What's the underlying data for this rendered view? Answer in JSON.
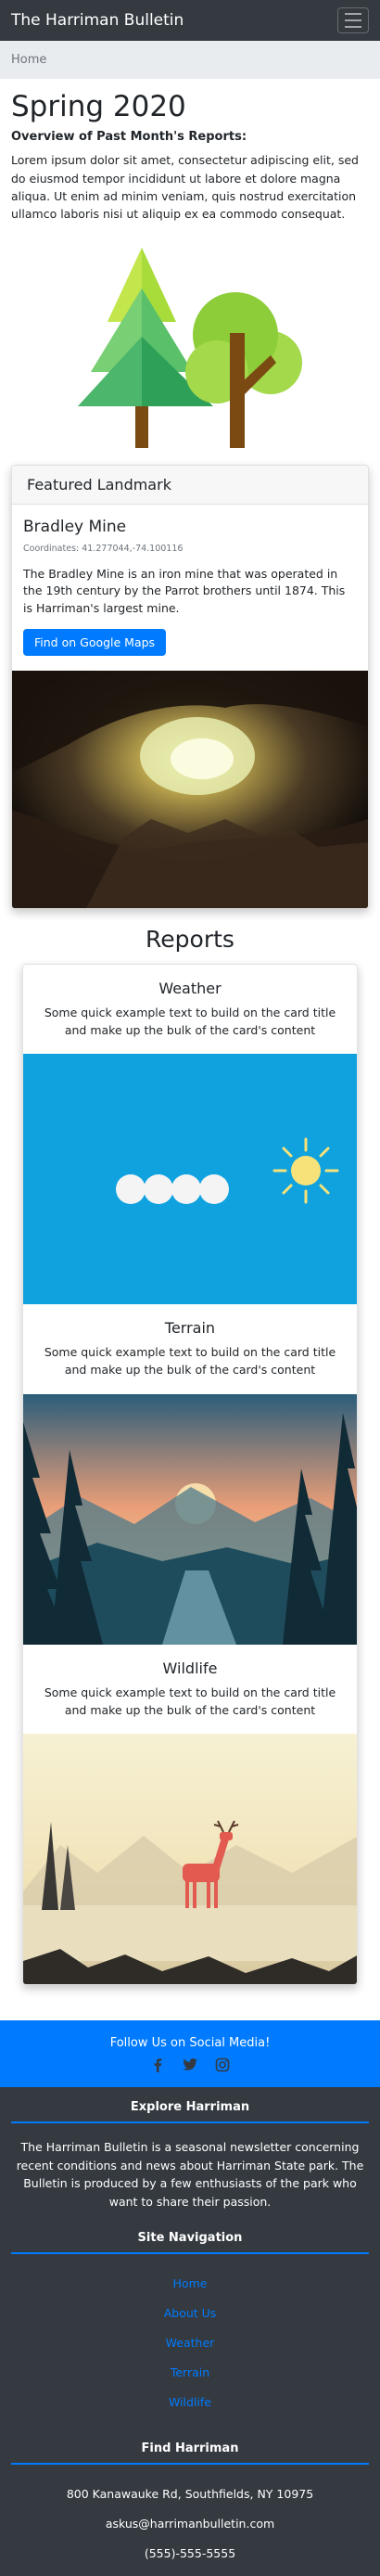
{
  "navbar": {
    "brand": "The Harriman Bulletin",
    "menu_icon": "hamburger-menu-icon"
  },
  "breadcrumb": {
    "home_label": "Home"
  },
  "intro": {
    "title": "Spring 2020",
    "subtitle": "Overview of Past Month's Reports:",
    "text": "Lorem ipsum dolor sit amet, consectetur adipiscing elit, sed do eiusmod tempor incididunt ut labore et dolore magna aliqua. Ut enim ad minim veniam, quis nostrud exercitation ullamco laboris nisi ut aliquip ex ea commodo consequat."
  },
  "featured": {
    "header": "Featured Landmark",
    "name": "Bradley Mine",
    "coordinates": "Coordinates: 41.277044,-74.100116",
    "description": "The Bradley Mine is an iron mine that was operated in the 19th century by the Parrot brothers until 1874. This is Harriman's largest mine.",
    "button_label": "Find on Google Maps"
  },
  "reports": {
    "heading": "Reports",
    "items": [
      {
        "title": "Weather",
        "text": "Some quick example text to build on the card title and make up the bulk of the card's content"
      },
      {
        "title": "Terrain",
        "text": "Some quick example text to build on the card title and make up the bulk of the card's content"
      },
      {
        "title": "Wildlife",
        "text": "Some quick example text to build on the card title and make up the bulk of the card's content"
      }
    ]
  },
  "social": {
    "heading": "Follow Us on Social Media!",
    "icons": [
      "facebook-icon",
      "twitter-icon",
      "instagram-icon"
    ]
  },
  "footer": {
    "explore_title": "Explore Harriman",
    "explore_text": "The Harriman Bulletin is a seasonal newsletter concerning recent conditions and news about Harriman State park. The Bulletin is produced by a few enthusiasts of the park who want to share their passion.",
    "nav_title": "Site Navigation",
    "nav_links": [
      "Home",
      "About Us",
      "Weather",
      "Terrain",
      "Wildlife"
    ],
    "find_title": "Find Harriman",
    "address": "800 Kanawauke Rd, Southfields, NY 10975",
    "email": "askus@harrimanbulletin.com",
    "phone": "(555)-555-5555"
  },
  "colors": {
    "navbar": "#343a40",
    "accent": "#007bff",
    "breadcrumb_bg": "#e9ecef",
    "footer": "#343a40"
  }
}
